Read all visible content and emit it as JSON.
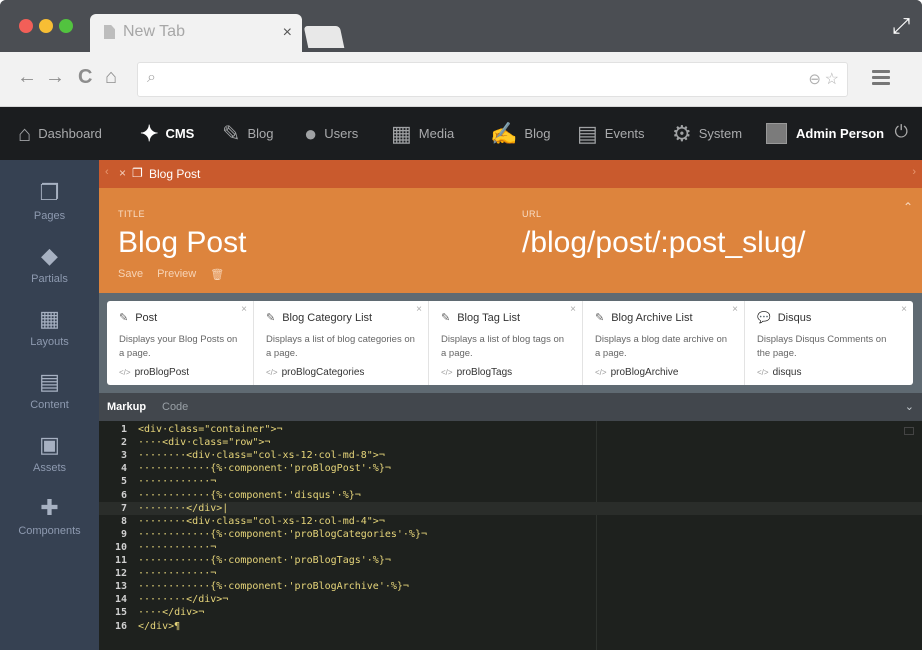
{
  "browser": {
    "tab_title": "New Tab",
    "tab_close": "×",
    "back": "←",
    "forward": "→",
    "reload": "C",
    "home": "⌂"
  },
  "nav": {
    "items": [
      {
        "label": "Dashboard",
        "icon": "home-icon",
        "glyph": "⌂"
      },
      {
        "label": "CMS",
        "icon": "magic-wand-icon",
        "glyph": "✦"
      },
      {
        "label": "Blog",
        "icon": "pencil-icon",
        "glyph": "✎"
      },
      {
        "label": "Users",
        "icon": "user-icon",
        "glyph": "●"
      },
      {
        "label": "Media",
        "icon": "film-icon",
        "glyph": "▦"
      },
      {
        "label": "Blog",
        "icon": "edit-icon",
        "glyph": "✍"
      },
      {
        "label": "Events",
        "icon": "calendar-icon",
        "glyph": "▤"
      },
      {
        "label": "System",
        "icon": "gear-icon",
        "glyph": "⚙"
      }
    ],
    "user_name": "Admin Person"
  },
  "sidebar": {
    "items": [
      {
        "label": "Pages",
        "icon": "pages-icon",
        "glyph": "❐"
      },
      {
        "label": "Partials",
        "icon": "tag-icon",
        "glyph": "◆"
      },
      {
        "label": "Layouts",
        "icon": "grid-icon",
        "glyph": "▦"
      },
      {
        "label": "Content",
        "icon": "document-icon",
        "glyph": "▤"
      },
      {
        "label": "Assets",
        "icon": "image-icon",
        "glyph": "▣"
      },
      {
        "label": "Components",
        "icon": "puzzle-icon",
        "glyph": "✚"
      }
    ]
  },
  "editor_tab": {
    "label": "Blog Post"
  },
  "header": {
    "title_label": "TITLE",
    "title_value": "Blog Post",
    "url_label": "URL",
    "url_value": "/blog/post/:post_slug/",
    "save_label": "Save",
    "preview_label": "Preview"
  },
  "components": [
    {
      "title": "Post",
      "description": "Displays your Blog Posts on a page.",
      "alias": "proBlogPost"
    },
    {
      "title": "Blog Category List",
      "description": "Displays a list of blog categories on a page.",
      "alias": "proBlogCategories"
    },
    {
      "title": "Blog Tag List",
      "description": "Displays a list of blog tags on a page.",
      "alias": "proBlogTags"
    },
    {
      "title": "Blog Archive List",
      "description": "Displays a blog date archive on a page.",
      "alias": "proBlogArchive"
    },
    {
      "title": "Disqus",
      "description": "Displays Disqus Comments on the page.",
      "alias": "disqus"
    }
  ],
  "markup_tabs": {
    "markup": "Markup",
    "code": "Code"
  },
  "code_lines": [
    "<div·class=\"container\">¬",
    "····<div·class=\"row\">¬",
    "········<div·class=\"col-xs-12·col-md-8\">¬",
    "············{%·component·'proBlogPost'·%}¬",
    "············¬",
    "············{%·component·'disqus'·%}¬",
    "········</div>|",
    "········<div·class=\"col-xs-12·col-md-4\">¬",
    "············{%·component·'proBlogCategories'·%}¬",
    "············¬",
    "············{%·component·'proBlogTags'·%}¬",
    "············¬",
    "············{%·component·'proBlogArchive'·%}¬",
    "········</div>¬",
    "····</div>¬",
    "</div>¶"
  ],
  "colors": {
    "accent_orange": "#dd843d",
    "tab_bar": "#c95a2d",
    "sidebar": "#364152",
    "nav_bg": "#1b1d1f"
  }
}
